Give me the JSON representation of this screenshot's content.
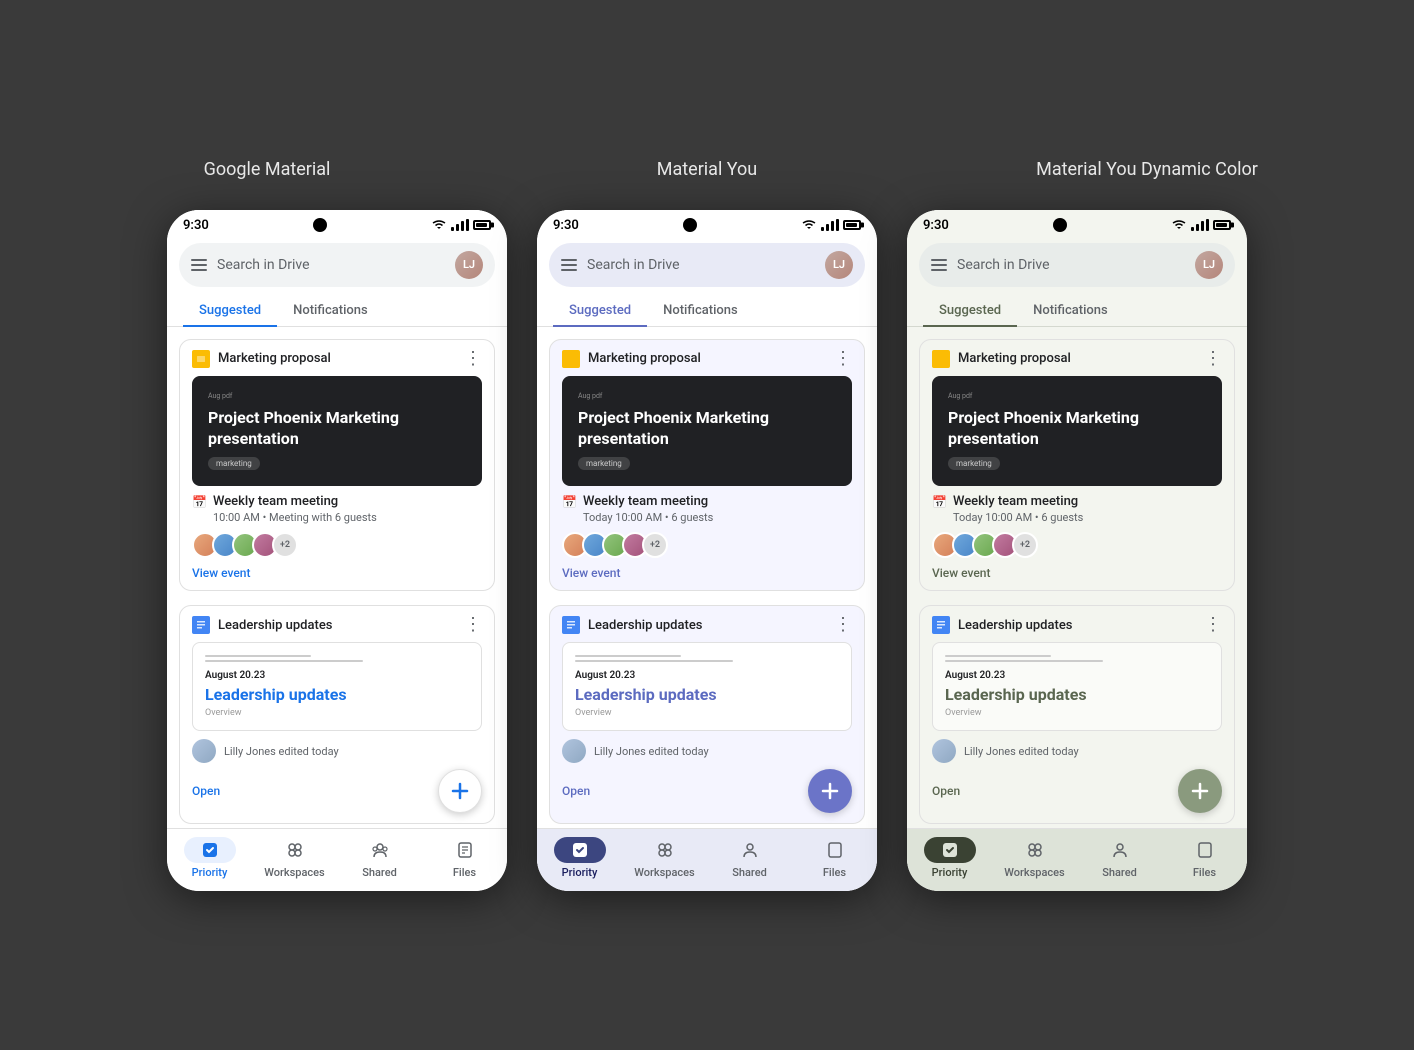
{
  "background": "#3a3a3a",
  "themes": [
    {
      "id": "gm",
      "label": "Google Material"
    },
    {
      "id": "my",
      "label": "Material You"
    },
    {
      "id": "mydc",
      "label": "Material You Dynamic Color"
    }
  ],
  "phone": {
    "status_time": "9:30",
    "search_placeholder": "Search in Drive",
    "tabs": [
      "Suggested",
      "Notifications"
    ],
    "card1": {
      "icon_type": "slides",
      "title": "Marketing proposal",
      "presentation_small": "Aug pdf",
      "presentation_title": "Project Phoenix Marketing presentation",
      "presentation_tag": "marketing"
    },
    "meeting": {
      "title": "Weekly team meeting",
      "time_gm": "10:00 AM • Meeting with 6 guests",
      "time_my": "Today 10:00 AM • 6 guests",
      "avatar_more": "+2",
      "view_event_label": "View event"
    },
    "card2": {
      "icon_type": "docs",
      "title": "Leadership updates",
      "doc_date": "August 20.23",
      "doc_title": "Leadership updates",
      "doc_overview": "Overview",
      "editor": "Lilly Jones edited today",
      "open_label": "Open"
    },
    "nav": {
      "items": [
        {
          "id": "priority",
          "label": "Priority",
          "icon": "check"
        },
        {
          "id": "workspaces",
          "label": "Workspaces",
          "icon": "grid"
        },
        {
          "id": "shared",
          "label": "Shared",
          "icon": "people"
        },
        {
          "id": "files",
          "label": "Files",
          "icon": "folder"
        }
      ]
    },
    "fab_label": "+"
  }
}
